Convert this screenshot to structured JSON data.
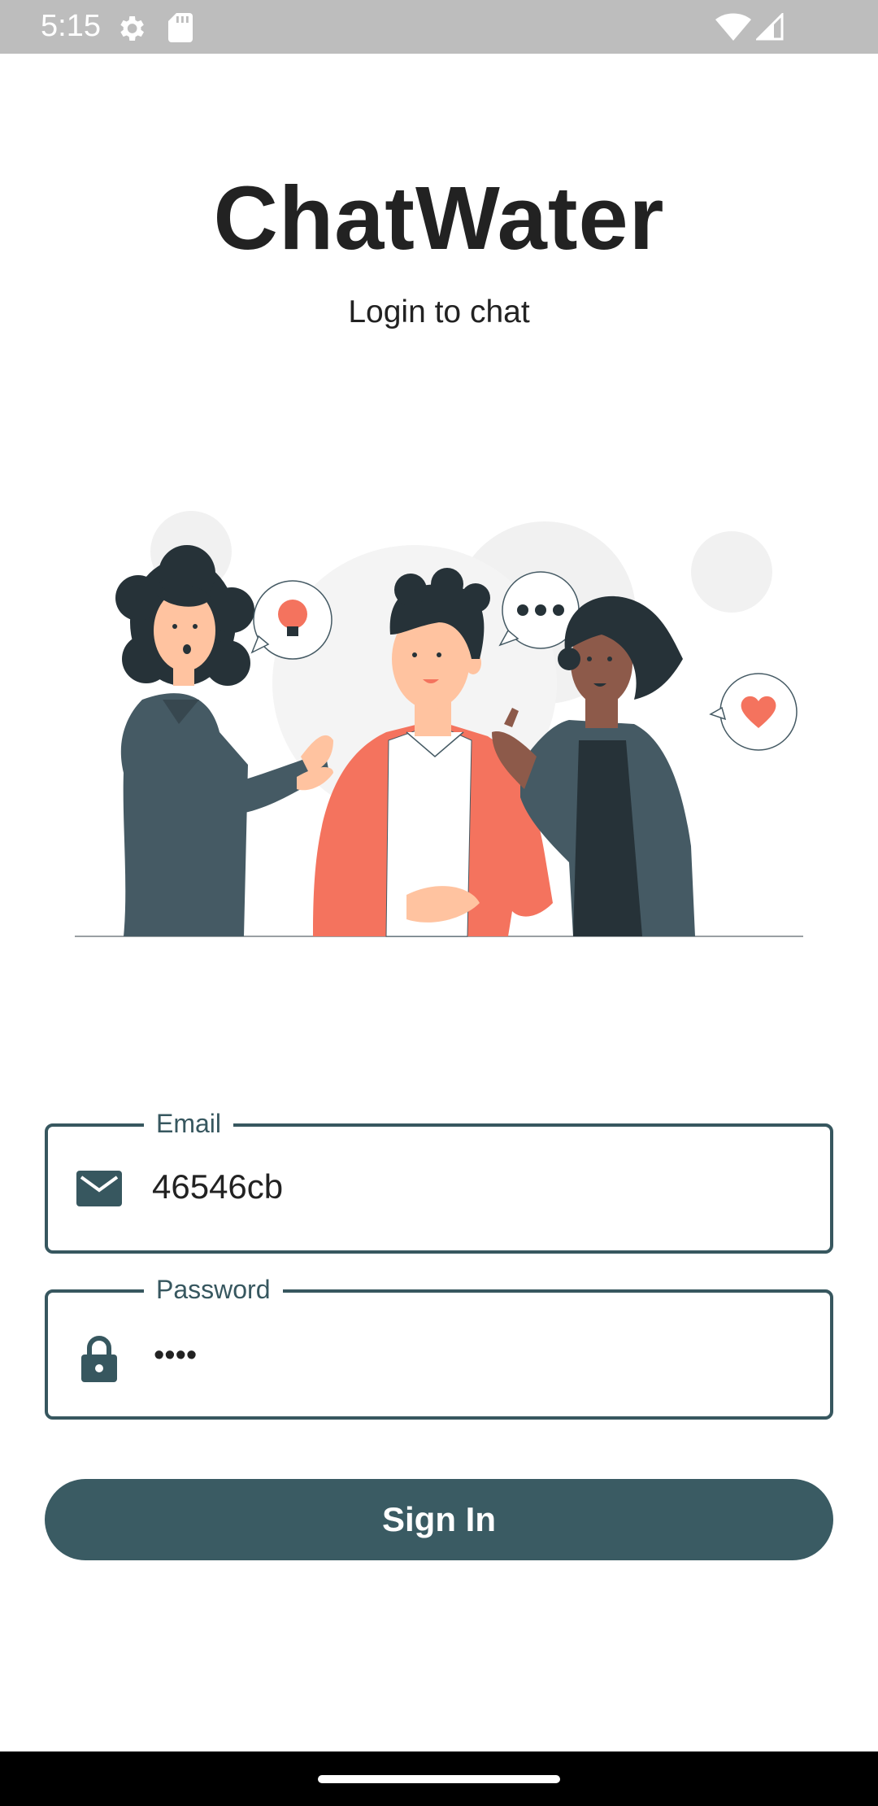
{
  "status_bar": {
    "time": "5:15",
    "icons": [
      "settings-gear-icon",
      "sd-card-icon",
      "wifi-icon",
      "cell-signal-icon"
    ]
  },
  "header": {
    "title": "ChatWater",
    "subtitle": "Login to chat"
  },
  "illustration": {
    "description_icon": "people-chatting-illustration",
    "bubbles": [
      "lightbulb-icon",
      "ellipsis-icon",
      "heart-icon"
    ]
  },
  "form": {
    "email": {
      "label": "Email",
      "value": "46546cb",
      "icon": "mail-icon"
    },
    "password": {
      "label": "Password",
      "value": "••••",
      "icon": "lock-icon"
    },
    "submit_label": "Sign In"
  },
  "colors": {
    "accent": "#3a5b63",
    "field_border": "#37575f",
    "status_bar": "#bdbdbd",
    "coral": "#f4735e",
    "dark_slate": "#455a64"
  }
}
